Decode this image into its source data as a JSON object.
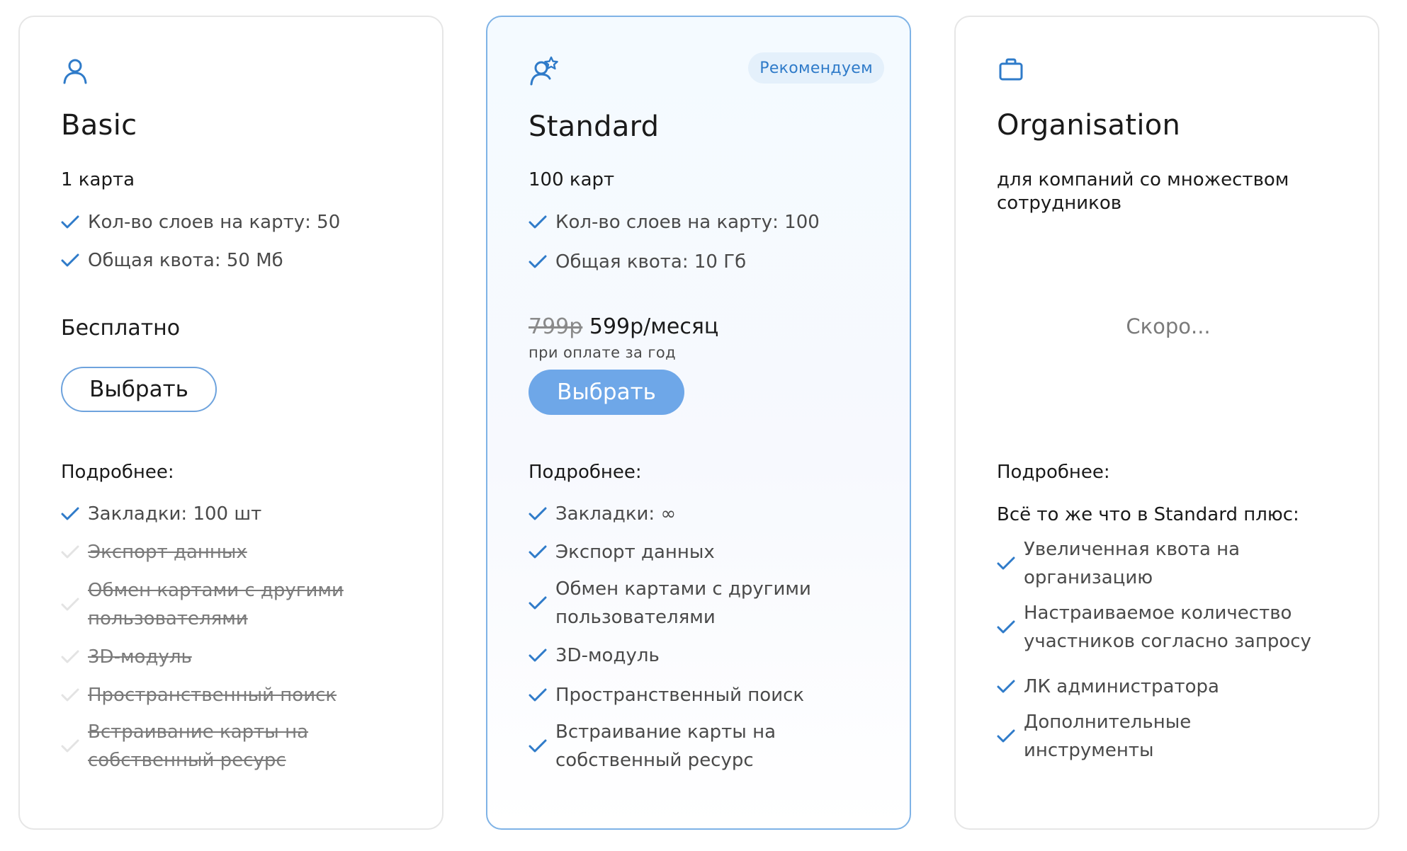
{
  "plans": {
    "basic": {
      "icon": "user-icon",
      "title": "Basic",
      "subtitle": "1 карта",
      "features": [
        "Кол-во слоев на карту: 50",
        "Общая квота: 50 Мб"
      ],
      "price": "Бесплатно",
      "button_label": "Выбрать",
      "details_label": "Подробнее:",
      "details": [
        {
          "text": "Закладки: 100 шт",
          "enabled": true
        },
        {
          "text": "Экспорт данных",
          "enabled": false
        },
        {
          "text": "Обмен картами с другими пользователями",
          "enabled": false
        },
        {
          "text": "3D-модуль",
          "enabled": false
        },
        {
          "text": "Пространственный поиск",
          "enabled": false
        },
        {
          "text": "Встраивание карты на собственный ресурс",
          "enabled": false
        }
      ]
    },
    "standard": {
      "icon": "user-star-icon",
      "badge": "Рекомендуем",
      "title": "Standard",
      "subtitle": "100 карт",
      "features": [
        "Кол-во слоев на карту: 100",
        "Общая квота: 10 Гб"
      ],
      "old_price": "799р",
      "price": "599р/месяц",
      "price_note": "при оплате за год",
      "button_label": "Выбрать",
      "details_label": "Подробнее:",
      "details": [
        {
          "text": "Закладки: ∞",
          "enabled": true
        },
        {
          "text": "Экспорт данных",
          "enabled": true
        },
        {
          "text": "Обмен картами с другими пользователями",
          "enabled": true
        },
        {
          "text": "3D-модуль",
          "enabled": true
        },
        {
          "text": "Пространственный поиск",
          "enabled": true
        },
        {
          "text": "Встраивание карты на собственный ресурс",
          "enabled": true
        }
      ]
    },
    "organisation": {
      "icon": "briefcase-icon",
      "title": "Organisation",
      "subtitle": "для компаний со множеством сотрудников",
      "soon": "Скоро...",
      "details_label": "Подробнее:",
      "details_lead": "Всё то же что в Standard плюс:",
      "details": [
        {
          "text": "Увеличенная квота на организацию",
          "enabled": true
        },
        {
          "text": "Настраиваемое количество участников согласно запросу",
          "enabled": true
        },
        {
          "text": "ЛК администратора",
          "enabled": true
        },
        {
          "text": "Дополнительные инструменты",
          "enabled": true
        }
      ]
    }
  },
  "colors": {
    "accent": "#2f7bc9",
    "button_filled": "#6ea7e8",
    "button_outline_border": "#6ea3dd",
    "featured_card_border": "#7fb3e6",
    "badge_bg": "#e4f0fb",
    "card_border": "#e6e6e6"
  }
}
